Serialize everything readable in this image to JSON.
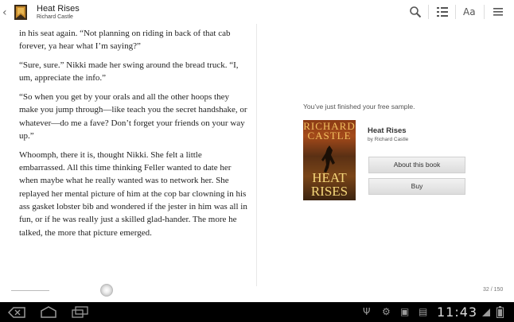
{
  "header": {
    "title": "Heat Rises",
    "author": "Richard Castle",
    "font_icon_text": "Aa"
  },
  "left_page": {
    "paragraphs": [
      "in his seat again. “Not planning on riding in back of that cab forever, ya hear what I’m saying?”",
      "“Sure, sure.” Nikki made her swing around the bread truck. “I, um, appreciate the info.”",
      "“So when you get by your orals and all the other hoops they make you jump through—like teach you the secret handshake, or whatever—do me a fave? Don’t forget your friends on your way up.”",
      "Whoomph, there it is, thought Nikki. She felt a little embarrassed. All this time thinking Feller wanted to date her when maybe what he really wanted was to network her. She replayed her mental picture of him at the cop bar clowning in his ass gasket lobster bib and wondered if the jester in him was all in fun, or if he was really just a skilled glad-hander. The more he talked, the more that picture emerged."
    ]
  },
  "right_page": {
    "sample_message": "You’ve just finished your free sample.",
    "book_title": "Heat Rises",
    "book_author": "by Richard Castle",
    "cover_author": "RICHARD CASTLE",
    "cover_title_line1": "HEAT",
    "cover_title_line2": "RISES",
    "about_button": "About this book",
    "buy_button": "Buy"
  },
  "footer": {
    "page_indicator": "32 / 150"
  },
  "system_bar": {
    "clock": "11:43"
  },
  "icons": {
    "back": "back-chevron-icon",
    "app": "books-app-icon",
    "search": "search-icon",
    "contents": "table-of-contents-icon",
    "view": "view-settings-icon",
    "menu": "menu-icon",
    "nav_back": "nav-back-icon",
    "nav_home": "nav-home-icon",
    "nav_recent": "recent-apps-icon"
  },
  "colors": {
    "cover": "#8a3a14",
    "cover_text": "#f2c060",
    "system_bar": "#000000"
  }
}
